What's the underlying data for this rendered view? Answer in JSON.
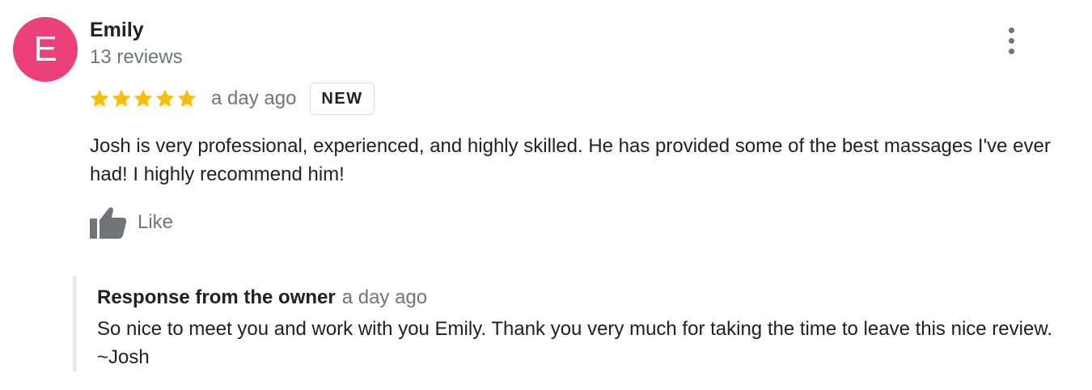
{
  "reviewer": {
    "initial": "E",
    "name": "Emily",
    "review_count": "13 reviews"
  },
  "rating": {
    "stars": 5,
    "max_stars": 5
  },
  "review": {
    "date": "a day ago",
    "badge": "NEW",
    "text": "Josh is very professional, experienced, and highly skilled. He has provided some of the best massages I've ever had! I highly recommend him!"
  },
  "actions": {
    "like_label": "Like",
    "more_icon": "more-vert-icon",
    "like_icon": "thumbs-up-icon"
  },
  "owner_response": {
    "title": "Response from the owner",
    "date": "a day ago",
    "text": "So nice to meet you and work with you Emily. Thank you very much for taking the time to leave this nice review. ~Josh"
  },
  "colors": {
    "avatar_bg": "#ec407a",
    "star": "#fbbc04",
    "icon_gray": "#70757a",
    "text": "#202124",
    "secondary_text": "#70757a"
  }
}
